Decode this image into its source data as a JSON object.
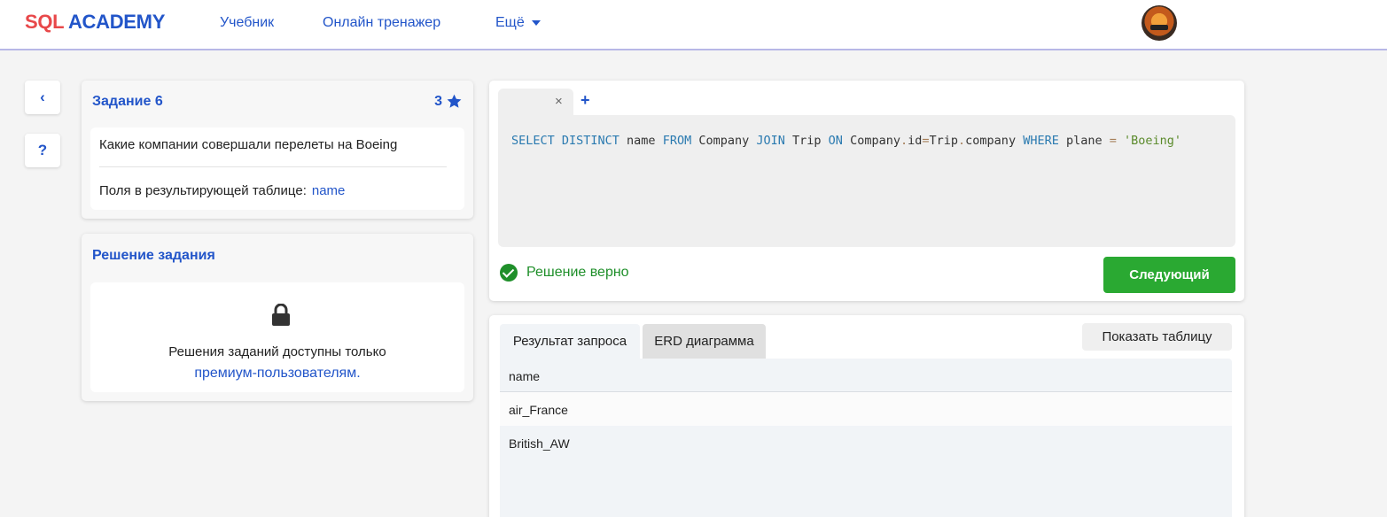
{
  "header": {
    "logo_part1": "SQL",
    "logo_part2": "ACADEMY",
    "nav": [
      "Учебник",
      "Онлайн тренажер",
      "Ещё"
    ],
    "avatar_icon": "user-avatar"
  },
  "side": {
    "back_label": "‹",
    "help_label": "?"
  },
  "task": {
    "title": "Задание 6",
    "score": "3",
    "question": "Какие компании совершали перелеты на Boeing",
    "fields_label": "Поля в результирующей таблице:",
    "fields_value": "name"
  },
  "solution": {
    "title": "Решение задания",
    "locked_text": "Решения заданий доступны только",
    "premium_link": "премиум-пользователям."
  },
  "editor": {
    "tab_close": "×",
    "add_tab": "+",
    "query_tokens": [
      {
        "t": "SELECT DISTINCT",
        "c": "kw"
      },
      {
        "t": " name ",
        "c": ""
      },
      {
        "t": "FROM",
        "c": "kw"
      },
      {
        "t": " Company ",
        "c": ""
      },
      {
        "t": "JOIN",
        "c": "kw"
      },
      {
        "t": " Trip ",
        "c": ""
      },
      {
        "t": "ON",
        "c": "kw"
      },
      {
        "t": " Company",
        "c": ""
      },
      {
        "t": ".",
        "c": "op"
      },
      {
        "t": "id",
        "c": ""
      },
      {
        "t": "=",
        "c": "op"
      },
      {
        "t": "Trip",
        "c": ""
      },
      {
        "t": ".",
        "c": "op"
      },
      {
        "t": "company ",
        "c": ""
      },
      {
        "t": "WHERE",
        "c": "kw"
      },
      {
        "t": " plane ",
        "c": ""
      },
      {
        "t": "=",
        "c": "op"
      },
      {
        "t": " 'Boeing'",
        "c": "str"
      }
    ],
    "status_text": "Решение верно",
    "next_label": "Следующий"
  },
  "results": {
    "tab_result": "Результат запроса",
    "tab_erd": "ERD диаграмма",
    "show_table": "Показать таблицу",
    "column": "name",
    "rows": [
      "air_France",
      "British_AW"
    ]
  },
  "colors": {
    "accent": "#2255c9",
    "logo_red": "#e8484a",
    "success": "#1f8f2a",
    "next_button": "#2aa932"
  }
}
